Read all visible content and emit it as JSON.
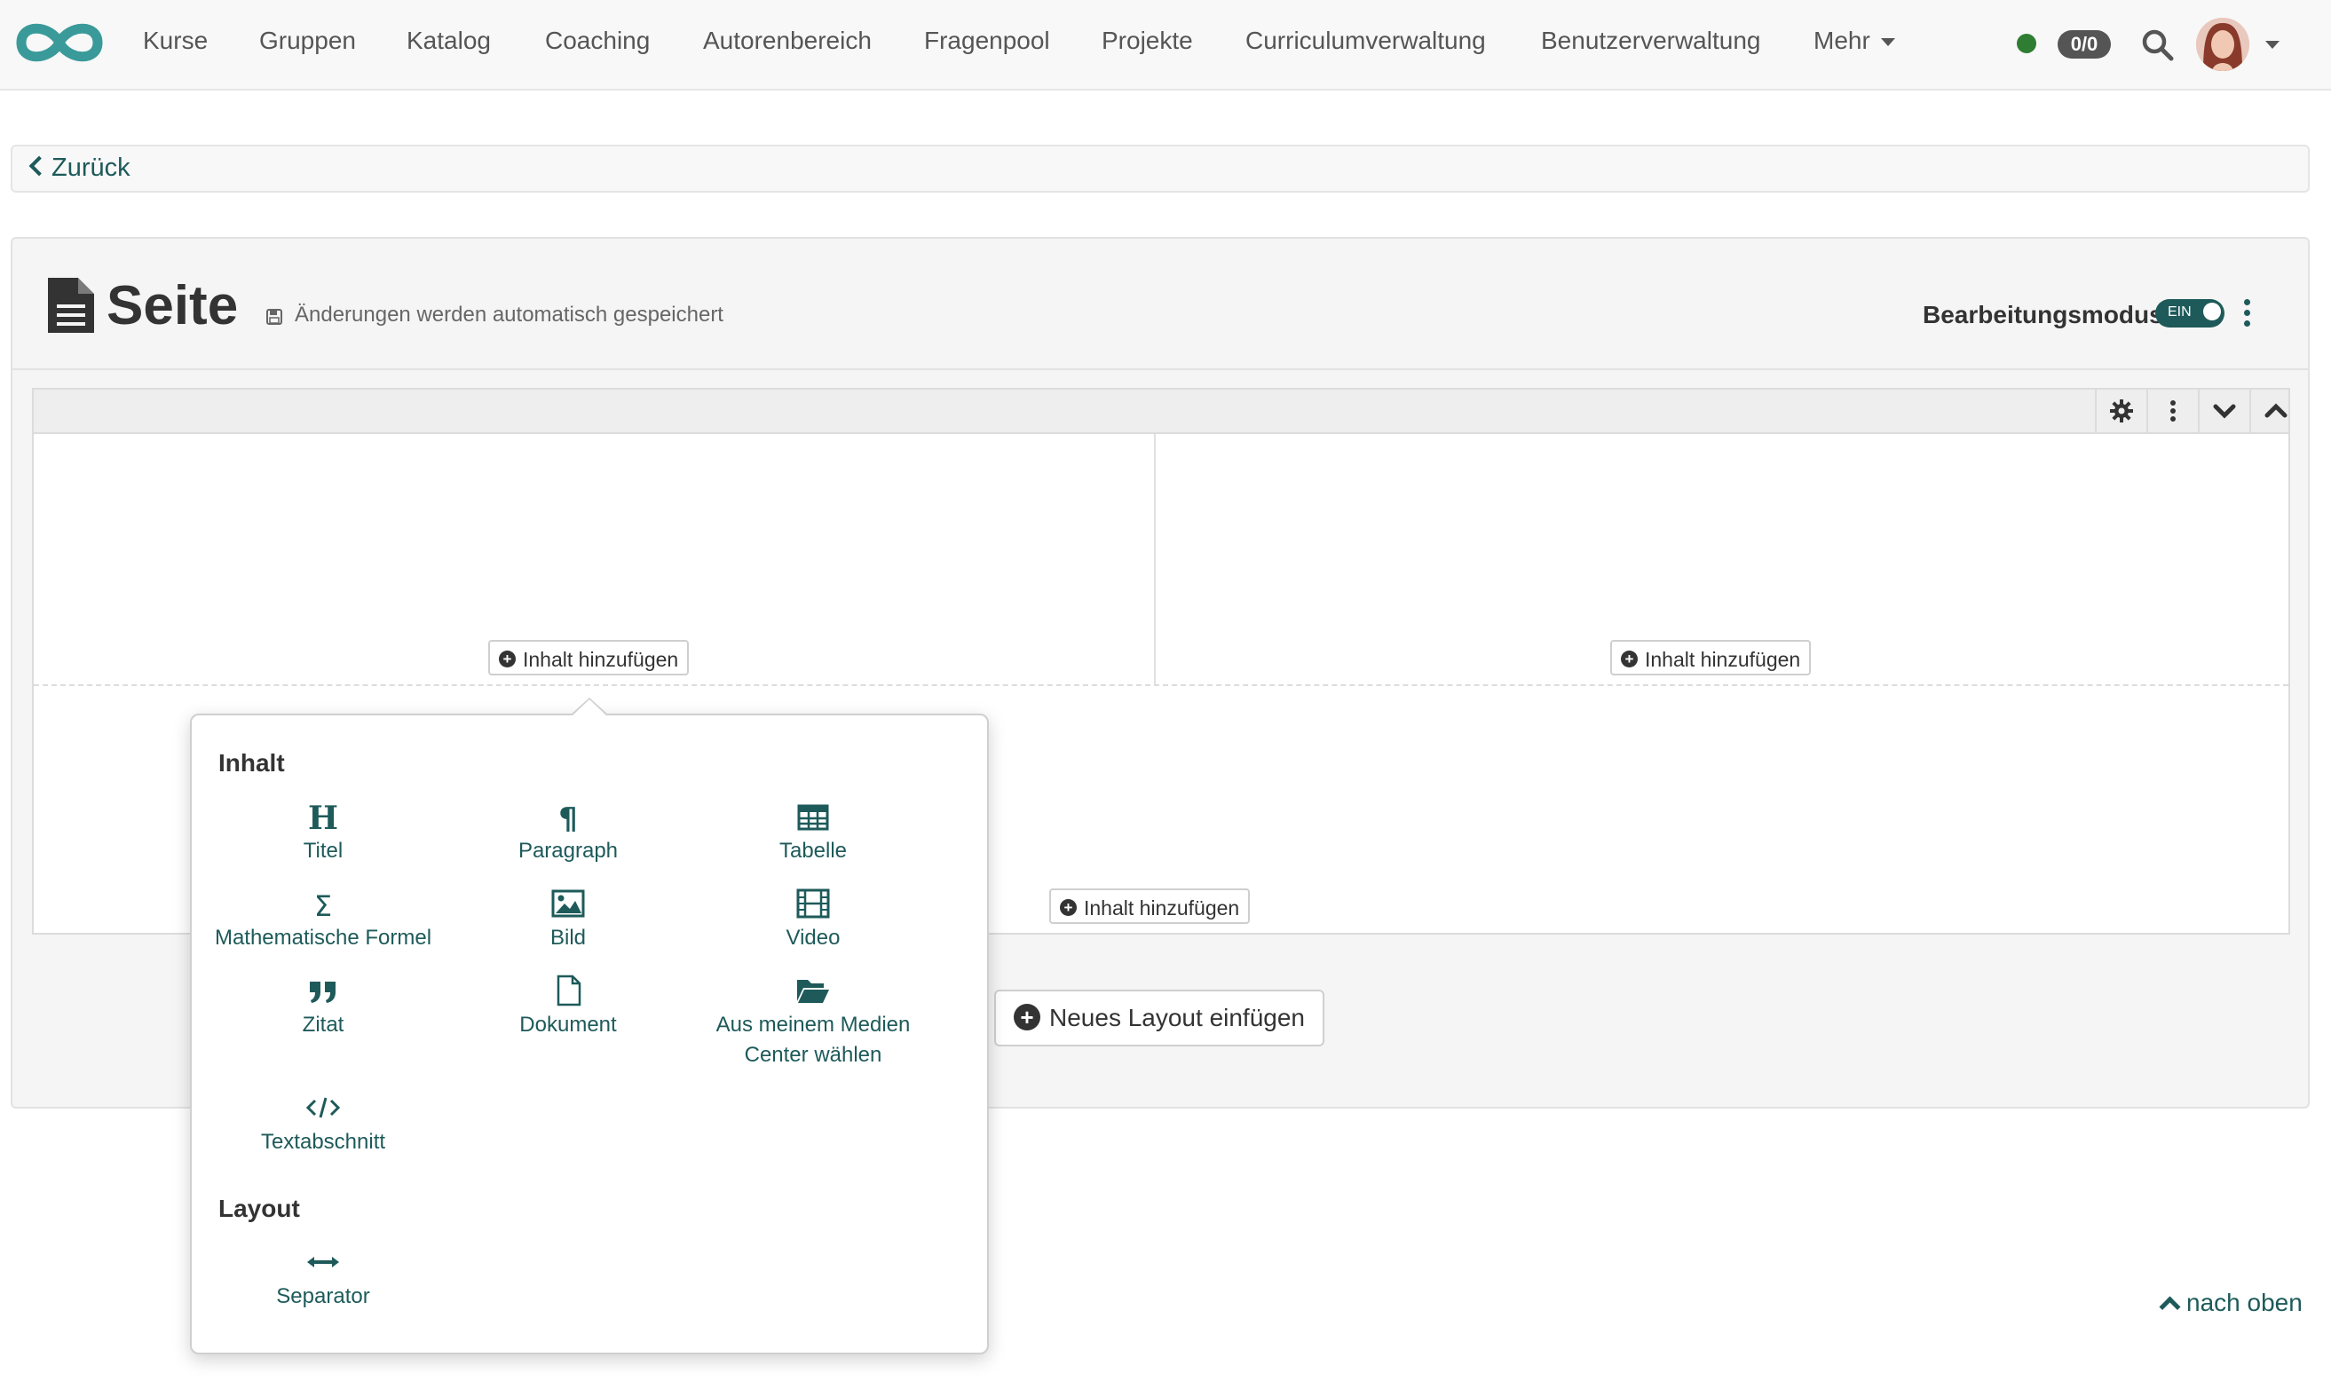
{
  "nav": {
    "items": [
      "Kurse",
      "Gruppen",
      "Katalog",
      "Coaching",
      "Autorenbereich",
      "Fragenpool",
      "Projekte",
      "Curriculumverwaltung",
      "Benutzerverwaltung"
    ],
    "more_label": "Mehr",
    "notification_count": "0/0",
    "status_color": "#2e7d32"
  },
  "back": {
    "label": "Zurück"
  },
  "page": {
    "title": "Seite",
    "autosave_note": "Änderungen werden automatisch gespeichert",
    "edit_mode_label": "Bearbeitungsmodus",
    "toggle_text": "EIN"
  },
  "layout": {
    "add_content_label": "Inhalt hinzufügen",
    "toolbar_icons": [
      "gear-icon",
      "kebab-icon",
      "chevron-down-icon",
      "chevron-up-icon"
    ]
  },
  "new_layout_label": "Neues Layout einfügen",
  "popover": {
    "content_heading": "Inhalt",
    "items": [
      {
        "label": "Titel",
        "icon": "heading-icon"
      },
      {
        "label": "Paragraph",
        "icon": "paragraph-icon"
      },
      {
        "label": "Tabelle",
        "icon": "table-icon"
      },
      {
        "label": "Mathematische Formel",
        "icon": "sigma-icon"
      },
      {
        "label": "Bild",
        "icon": "image-icon"
      },
      {
        "label": "Video",
        "icon": "film-icon"
      },
      {
        "label": "Zitat",
        "icon": "quote-icon"
      },
      {
        "label": "Dokument",
        "icon": "document-icon"
      },
      {
        "label": "Aus meinem Medien Center wählen",
        "icon": "folder-open-icon"
      },
      {
        "label": "Textabschnitt",
        "icon": "code-icon"
      }
    ],
    "layout_heading": "Layout",
    "layout_items": [
      {
        "label": "Separator",
        "icon": "separator-icon"
      }
    ]
  },
  "to_top_label": "nach oben",
  "colors": {
    "accent": "#1e5a5a",
    "logo": "#3a9a9a"
  }
}
